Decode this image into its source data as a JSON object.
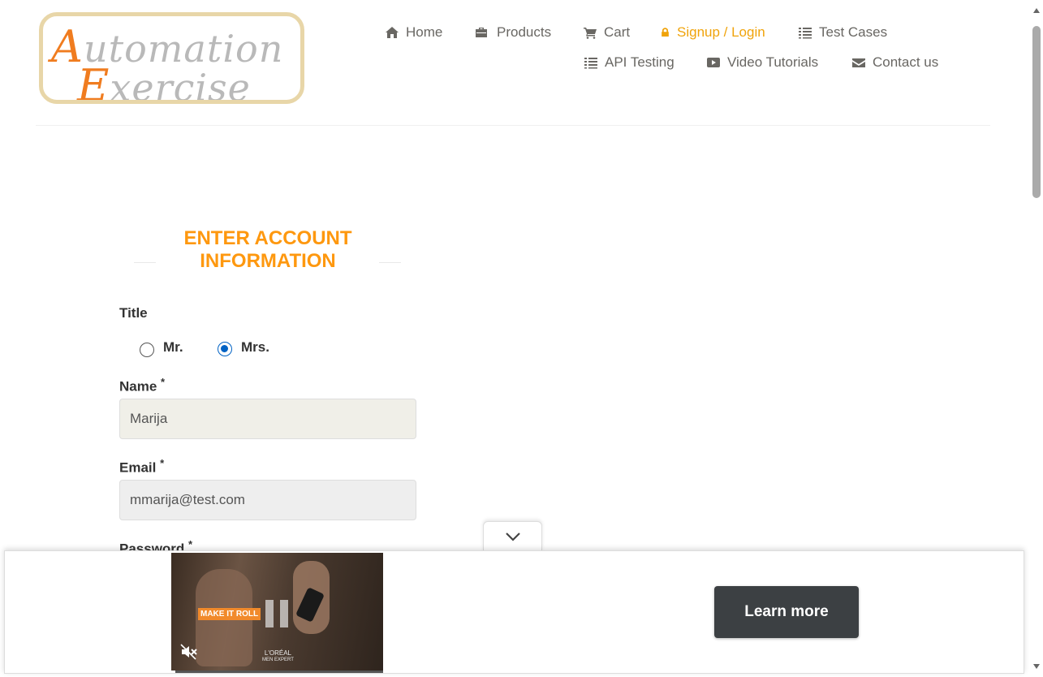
{
  "logo": {
    "line1_cap": "A",
    "line1_rest": "utomation",
    "line2_cap": "E",
    "line2_rest": "xercise"
  },
  "nav": {
    "home": "Home",
    "products": "Products",
    "cart": "Cart",
    "signup_login": "Signup / Login",
    "test_cases": "Test Cases",
    "api_testing": "API Testing",
    "video_tutorials": "Video Tutorials",
    "contact_us": "Contact us"
  },
  "form": {
    "heading_line1": "ENTER ACCOUNT",
    "heading_line2": "INFORMATION",
    "title_label": "Title",
    "title_options": [
      "Mr.",
      "Mrs."
    ],
    "title_selected": "Mrs.",
    "name_label": "Name",
    "name_value": "Marija",
    "email_label": "Email",
    "email_value": "mmarija@test.com",
    "password_label": "Password",
    "required_mark": "*"
  },
  "ad": {
    "tagline": "MAKE IT ROLL",
    "brand_line1": "L'ORÉAL",
    "brand_line2": "MEN EXPERT",
    "cta": "Learn more",
    "progress": 0.02
  },
  "colors": {
    "accent": "#fe980f",
    "active_nav": "#f0a30a",
    "cta_bg": "#3c4043"
  }
}
